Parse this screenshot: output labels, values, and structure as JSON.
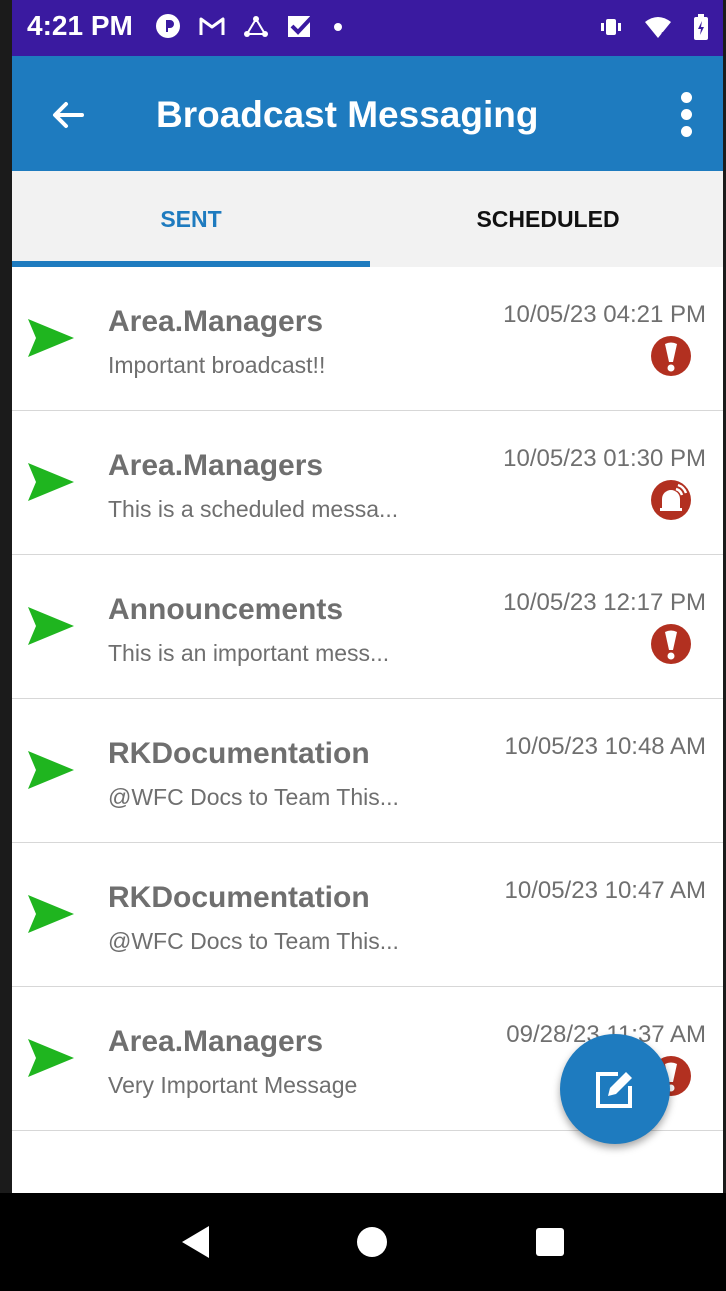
{
  "status_bar": {
    "time": "4:21 PM",
    "left_icons": [
      "record-icon",
      "gmail-icon",
      "network-icon",
      "checkbox-icon",
      "dot-icon"
    ],
    "right_icons": [
      "vibrate-icon",
      "wifi-icon",
      "battery-icon"
    ],
    "color": "#3a1aa0"
  },
  "app_bar": {
    "title": "Broadcast Messaging",
    "back_icon": "arrow-back-icon",
    "menu_icon": "more-vert-icon",
    "color": "#1e7bbf"
  },
  "tabs": [
    {
      "label": "SENT",
      "selected": true
    },
    {
      "label": "SCHEDULED",
      "selected": false
    }
  ],
  "messages": [
    {
      "sender": "Area.Managers",
      "preview": "Important broadcast!!",
      "time": "10/05/23 04:21 PM",
      "badge": "exclamation"
    },
    {
      "sender": "Area.Managers",
      "preview": "This is a scheduled messa...",
      "time": "10/05/23 01:30 PM",
      "badge": "alarm"
    },
    {
      "sender": "Announcements",
      "preview": "This is an important mess...",
      "time": "10/05/23 12:17 PM",
      "badge": "exclamation"
    },
    {
      "sender": "RKDocumentation",
      "preview": "@WFC Docs to Team This...",
      "time": "10/05/23 10:48 AM",
      "badge": ""
    },
    {
      "sender": "RKDocumentation",
      "preview": "@WFC Docs to Team This...",
      "time": "10/05/23 10:47 AM",
      "badge": ""
    },
    {
      "sender": "Area.Managers",
      "preview": "Very Important Message",
      "time": "09/28/23 11:37 AM",
      "badge": "exclamation"
    }
  ],
  "fab": {
    "icon": "compose-icon"
  },
  "colors": {
    "send_green": "#1fb51f",
    "priority_red": "#b23020",
    "text_gray": "#6f6f6f"
  }
}
